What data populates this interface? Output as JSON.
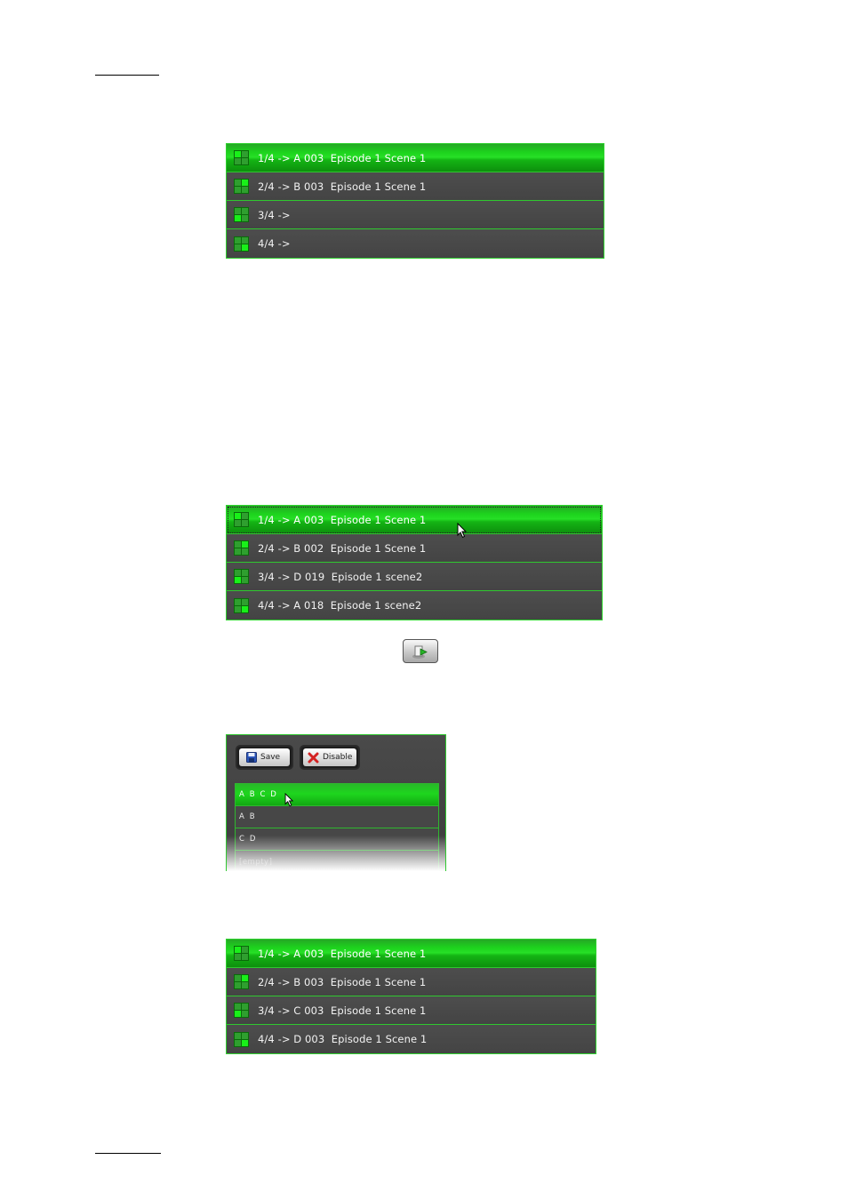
{
  "panel1": {
    "rows": [
      {
        "label": "1/4 -> A 003  Episode 1 Scene 1",
        "active": true,
        "cells": [
          1,
          0,
          0,
          0
        ]
      },
      {
        "label": "2/4 -> B 003  Episode 1 Scene 1",
        "active": false,
        "cells": [
          0,
          1,
          0,
          0
        ]
      },
      {
        "label": "3/4 ->",
        "active": false,
        "cells": [
          0,
          0,
          1,
          0
        ]
      },
      {
        "label": "4/4 ->",
        "active": false,
        "cells": [
          0,
          0,
          0,
          1
        ]
      }
    ]
  },
  "panel2": {
    "rows": [
      {
        "label": "1/4 -> A 003  Episode 1 Scene 1",
        "active": true,
        "cells": [
          1,
          0,
          0,
          0
        ]
      },
      {
        "label": "2/4 -> B 002  Episode 1 Scene 1",
        "active": false,
        "cells": [
          0,
          1,
          0,
          0
        ]
      },
      {
        "label": "3/4 -> D 019  Episode 1 scene2",
        "active": false,
        "cells": [
          0,
          0,
          1,
          0
        ]
      },
      {
        "label": "4/4 -> A 018  Episode 1 scene2",
        "active": false,
        "cells": [
          0,
          0,
          0,
          1
        ]
      }
    ]
  },
  "apply_button": {
    "icon": "apply-layout-icon"
  },
  "layout_panel": {
    "save_label": "Save",
    "disable_label": "Disable",
    "items": [
      {
        "label": "A B C D",
        "active": true
      },
      {
        "label": "A B",
        "active": false
      },
      {
        "label": "C D",
        "active": false
      },
      {
        "label": "[empty]",
        "active": false
      }
    ]
  },
  "panel3": {
    "rows": [
      {
        "label": "1/4 -> A 003  Episode 1 Scene 1",
        "active": true,
        "cells": [
          1,
          0,
          0,
          0
        ]
      },
      {
        "label": "2/4 -> B 003  Episode 1 Scene 1",
        "active": false,
        "cells": [
          0,
          1,
          0,
          0
        ]
      },
      {
        "label": "3/4 -> C 003  Episode 1 Scene 1",
        "active": false,
        "cells": [
          0,
          0,
          1,
          0
        ]
      },
      {
        "label": "4/4 -> D 003  Episode 1 Scene 1",
        "active": false,
        "cells": [
          0,
          0,
          0,
          1
        ]
      }
    ]
  },
  "colors": {
    "accent_green": "#19f019",
    "panel_bg": "#444444",
    "border_green": "#2fc82f"
  }
}
